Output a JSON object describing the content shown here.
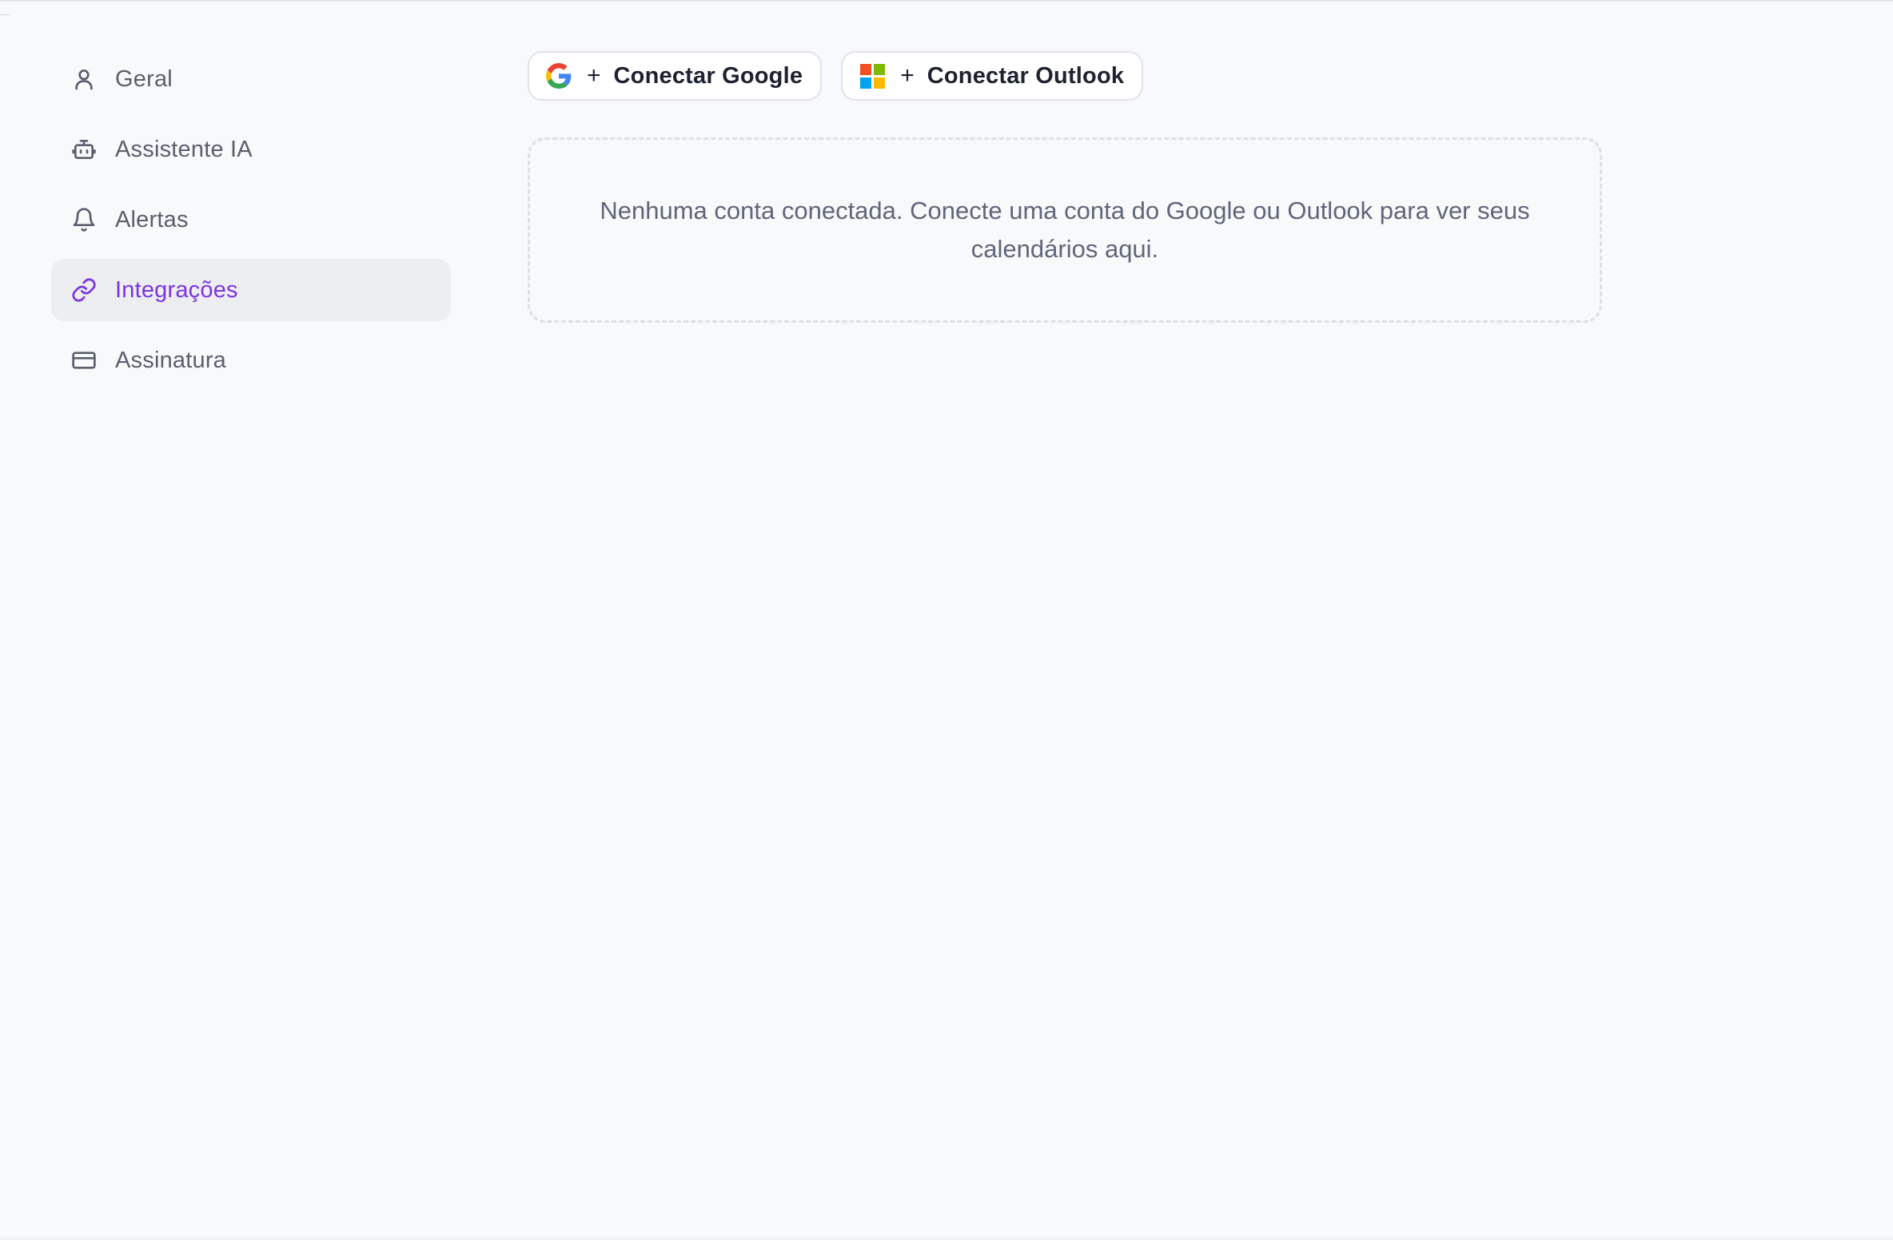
{
  "sidebar": {
    "items": [
      {
        "label": "Geral",
        "icon": "user-icon",
        "active": false
      },
      {
        "label": "Assistente IA",
        "icon": "bot-icon",
        "active": false
      },
      {
        "label": "Alertas",
        "icon": "bell-icon",
        "active": false
      },
      {
        "label": "Integrações",
        "icon": "link-icon",
        "active": true
      },
      {
        "label": "Assinatura",
        "icon": "credit-card-icon",
        "active": false
      }
    ]
  },
  "main": {
    "google_button": {
      "plus": "+",
      "label": "Conectar Google",
      "icon": "google-logo-icon"
    },
    "outlook_button": {
      "plus": "+",
      "label": "Conectar Outlook",
      "icon": "microsoft-logo-icon"
    },
    "empty_state": "Nenhuma conta conectada. Conecte uma conta do Google ou Outlook para ver seus calendários aqui."
  },
  "colors": {
    "background": "#f8f9fb",
    "accent": "#7b34e0",
    "nav_text": "#5a5f6e",
    "active_bg": "#eceef2"
  }
}
